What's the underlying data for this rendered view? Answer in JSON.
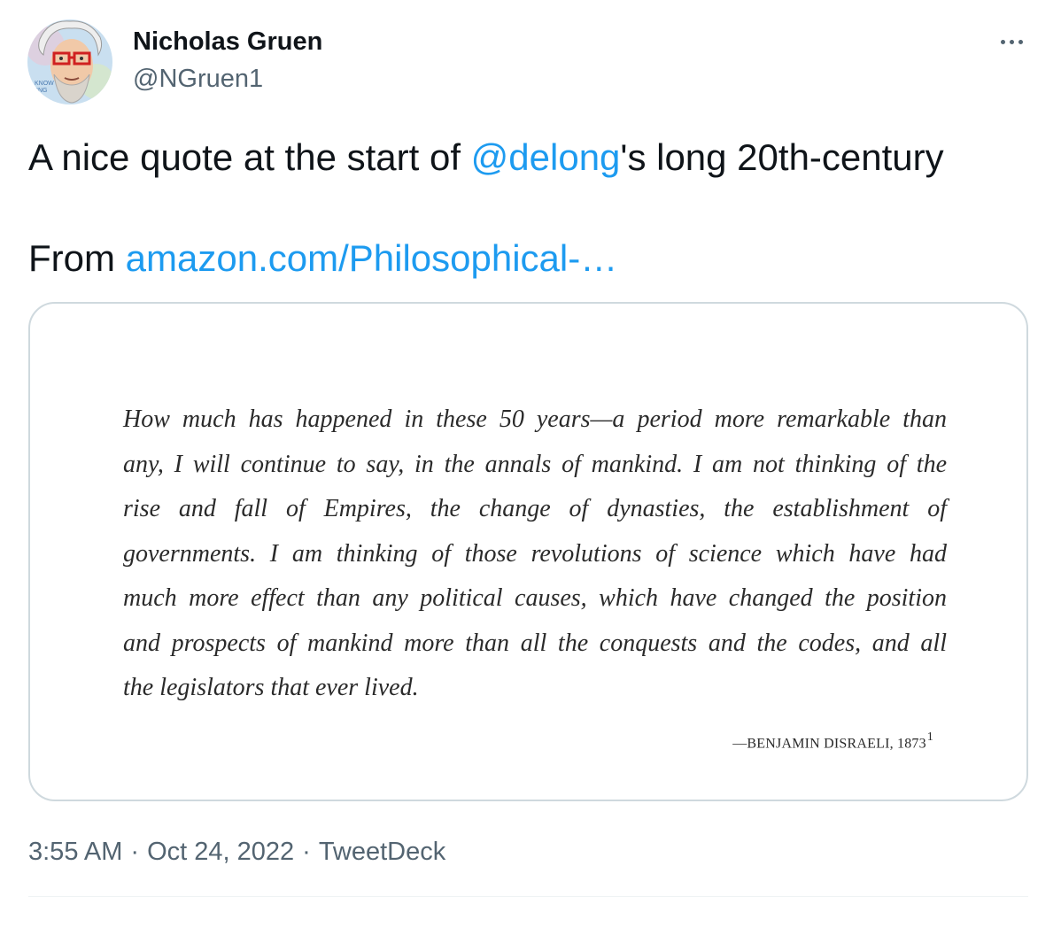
{
  "author": {
    "display_name": "Nicholas Gruen",
    "handle": "@NGruen1",
    "avatar_icon": "caricature-avatar-icon"
  },
  "more_icon": "more-horizontal-icon",
  "tweet": {
    "text_before_mention": "A nice quote at the start of ",
    "mention": "@delong",
    "text_after_mention": "'s long 20th-century",
    "from_label": "From ",
    "link_text": "amazon.com/Philosophical-…"
  },
  "media": {
    "quote_lines": [
      "How much has happened in these 50 years—a period more remarkable than",
      "any, I will continue to say, in the annals of mankind. I am not thinking of the",
      "rise and fall of Empires, the change of dynasties, the establishment of",
      "governments. I am thinking of those revolutions of science which have had",
      "much more effect than any political causes, which have changed the position",
      "and prospects of mankind more than all the conquests and the codes, and all",
      "the legislators that ever lived."
    ],
    "attribution": "—BENJAMIN DISRAELI, 1873",
    "footnote": "1"
  },
  "meta": {
    "time": "3:55 AM",
    "separator": "·",
    "date": "Oct 24, 2022",
    "source": "TweetDeck"
  },
  "colors": {
    "link": "#1d9bf0",
    "secondary_text": "#536471",
    "primary_text": "#0f1419",
    "border": "#cfd9de"
  }
}
